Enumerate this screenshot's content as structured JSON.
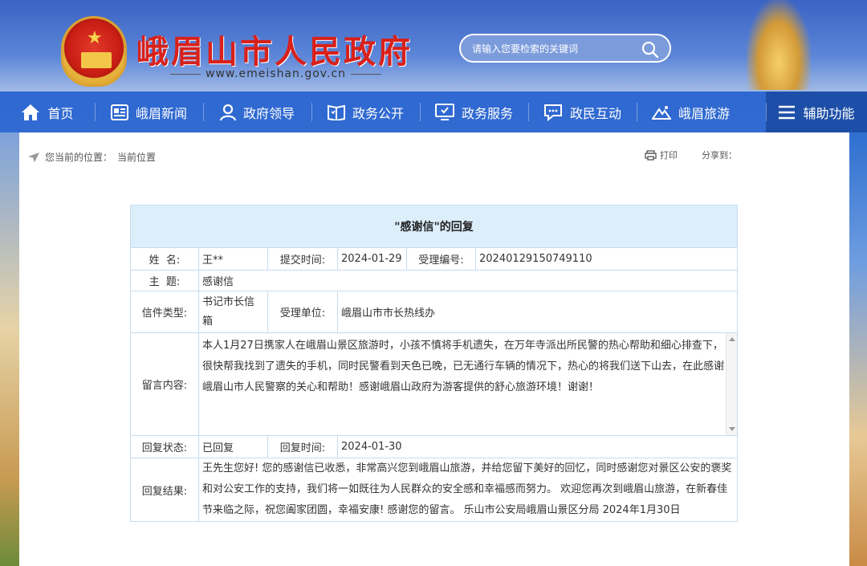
{
  "header": {
    "site_title": "峨眉山市人民政府",
    "site_url": "www.emeishan.gov.cn",
    "search_placeholder": "请输入您要检索的关键词"
  },
  "nav": {
    "items": [
      {
        "label": "首页",
        "icon": "home-icon"
      },
      {
        "label": "峨眉新闻",
        "icon": "news-icon"
      },
      {
        "label": "政府领导",
        "icon": "person-icon"
      },
      {
        "label": "政务公开",
        "icon": "book-icon"
      },
      {
        "label": "政务服务",
        "icon": "monitor-icon"
      },
      {
        "label": "政民互动",
        "icon": "chat-icon"
      },
      {
        "label": "峨眉旅游",
        "icon": "mountain-icon"
      }
    ],
    "assist_label": "辅助功能"
  },
  "breadcrumb": {
    "prefix": "您当前的位置：",
    "current": "当前位置"
  },
  "tools": {
    "print": "打印",
    "share": "分享到："
  },
  "letter": {
    "caption": "\"感谢信\"的回复",
    "name_label": "姓  名:",
    "name_value": "王**",
    "submit_time_label": "提交时间:",
    "submit_time_value": "2024-01-29",
    "ticket_label": "受理编号:",
    "ticket_value": "20240129150749110",
    "subject_label": "主  题:",
    "subject_value": "感谢信",
    "type_label": "信件类型:",
    "type_value": "书记市长信箱",
    "unit_label": "受理单位:",
    "unit_value": "峨眉山市市长热线办",
    "content_label": "留言内容:",
    "content_value": " 本人1月27日携家人在峨眉山景区旅游时，小孩不慎将手机遗失，在万年寺派出所民警的热心帮助和细心排查下，很快帮我找到了遗失的手机，同时民警看到天色已晚，已无通行车辆的情况下，热心的将我们送下山去，在此感谢峨眉山市人民警察的关心和帮助！感谢峨眉山政府为游客提供的舒心旅游环境！谢谢！",
    "status_label": "回复状态:",
    "status_value": "已回复",
    "reply_time_label": "回复时间:",
    "reply_time_value": "2024-01-30",
    "result_label": "回复结果:",
    "result_value": " 王先生您好! 您的感谢信已收悉，非常高兴您到峨眉山旅游，并给您留下美好的回忆，同时感谢您对景区公安的褒奖和对公安工作的支持，我们将一如既往为人民群众的安全感和幸福感而努力。 欢迎您再次到峨眉山旅游，在新春佳节来临之际，祝您阖家团圆，幸福安康! 感谢您的留言。 乐山市公安局峨眉山景区分局 2024年1月30日"
  },
  "colors": {
    "nav_bg": "#2662cf",
    "title_red": "#d8211b",
    "caption_bg": "#ddeefb",
    "border": "#c7dcef"
  }
}
